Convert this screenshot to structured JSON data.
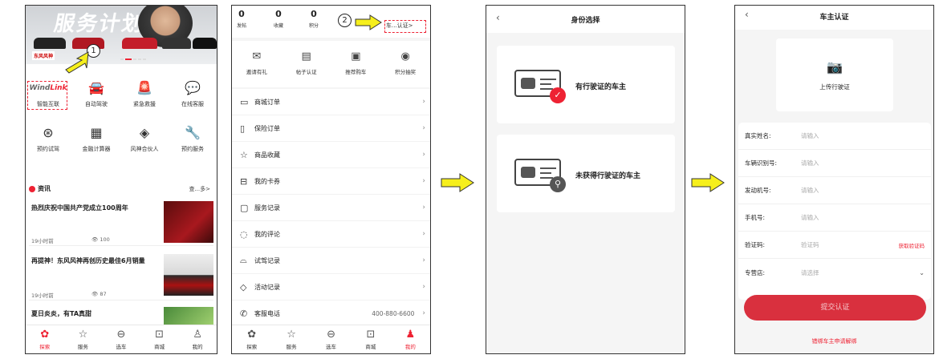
{
  "colors": {
    "accent": "#e23344",
    "submit": "#d9303e",
    "arrow": "#f6ef1c"
  },
  "screen1": {
    "banner": {
      "title": "服务计划",
      "logo": "东风风神"
    },
    "callout": "1",
    "grid": [
      {
        "label": "智能互联",
        "icon": "windlink-logo",
        "logo_text_a": "Wind",
        "logo_text_b": "Link"
      },
      {
        "label": "自动驾驶",
        "icon": "car-icon"
      },
      {
        "label": "紧急救援",
        "icon": "siren-icon"
      },
      {
        "label": "在线客服",
        "icon": "chat-icon"
      },
      {
        "label": "预约试驾",
        "icon": "steering-wheel-icon"
      },
      {
        "label": "金融计算器",
        "icon": "calculator-icon"
      },
      {
        "label": "风神合伙人",
        "icon": "partner-icon"
      },
      {
        "label": "预约服务",
        "icon": "service-icon"
      }
    ],
    "news": {
      "heading": "资讯",
      "more": "查...多>",
      "items": [
        {
          "title": "热烈庆祝中国共产党成立100周年",
          "time": "19小时前",
          "views": "100"
        },
        {
          "title": "再提神！东风风神再创历史最佳6月销量",
          "time": "19小时前",
          "views": "87"
        },
        {
          "title": "夏日炎炎，有TA真甜",
          "time": "",
          "views": ""
        }
      ]
    },
    "tabs": [
      {
        "label": "探索",
        "icon": "explore-icon",
        "active": true
      },
      {
        "label": "服务",
        "icon": "service-icon",
        "active": false
      },
      {
        "label": "选车",
        "icon": "car-icon",
        "active": false
      },
      {
        "label": "商城",
        "icon": "shop-icon",
        "active": false
      },
      {
        "label": "我的",
        "icon": "user-icon",
        "active": false
      }
    ]
  },
  "screen2": {
    "stats": [
      {
        "num": "0",
        "label": "发帖"
      },
      {
        "num": "0",
        "label": "收藏"
      },
      {
        "num": "0",
        "label": "积分"
      }
    ],
    "callout": "2",
    "verify": "车...认证>",
    "icons": [
      {
        "label": "邀请有礼",
        "icon": "invite-icon"
      },
      {
        "label": "帖子认证",
        "icon": "post-verify-icon"
      },
      {
        "label": "推荐购车",
        "icon": "recommend-icon"
      },
      {
        "label": "积分抽奖",
        "icon": "lottery-icon"
      }
    ],
    "menu": [
      {
        "label": "商城订单",
        "icon": "order-icon",
        "value": ""
      },
      {
        "label": "保险订单",
        "icon": "insurance-icon",
        "value": ""
      },
      {
        "label": "商品收藏",
        "icon": "star-icon",
        "value": ""
      },
      {
        "label": "我的卡券",
        "icon": "coupon-icon",
        "value": ""
      },
      {
        "label": "服务记录",
        "icon": "record-icon",
        "value": ""
      },
      {
        "label": "我的评论",
        "icon": "comment-icon",
        "value": ""
      },
      {
        "label": "试驾记录",
        "icon": "testdrive-icon",
        "value": ""
      },
      {
        "label": "活动记录",
        "icon": "activity-icon",
        "value": ""
      },
      {
        "label": "客服电话",
        "icon": "phone-icon",
        "value": "400-880-6600"
      }
    ],
    "tabs": [
      {
        "label": "探索",
        "icon": "explore-icon",
        "active": false
      },
      {
        "label": "服务",
        "icon": "service-icon",
        "active": false
      },
      {
        "label": "选车",
        "icon": "car-icon",
        "active": false
      },
      {
        "label": "商城",
        "icon": "shop-icon",
        "active": false
      },
      {
        "label": "我的",
        "icon": "user-icon",
        "active": true
      }
    ]
  },
  "screen3": {
    "title": "身份选择",
    "options": [
      {
        "label": "有行驶证的车主",
        "badge": "check-icon"
      },
      {
        "label": "未获得行驶证的车主",
        "badge": "search-icon"
      }
    ]
  },
  "screen4": {
    "title": "车主认证",
    "upload_label": "上传行驶证",
    "fields": [
      {
        "label": "真实姓名:",
        "placeholder": "请输入",
        "action": ""
      },
      {
        "label": "车辆识别号:",
        "placeholder": "请输入",
        "action": ""
      },
      {
        "label": "发动机号:",
        "placeholder": "请输入",
        "action": ""
      },
      {
        "label": "手机号:",
        "placeholder": "请输入",
        "action": ""
      },
      {
        "label": "验证码:",
        "placeholder": "验证码",
        "action": "获取验证码"
      },
      {
        "label": "专营店:",
        "placeholder": "请选择",
        "action": ""
      }
    ],
    "submit": "提交认证",
    "unbind": "错绑车主申请解绑"
  }
}
